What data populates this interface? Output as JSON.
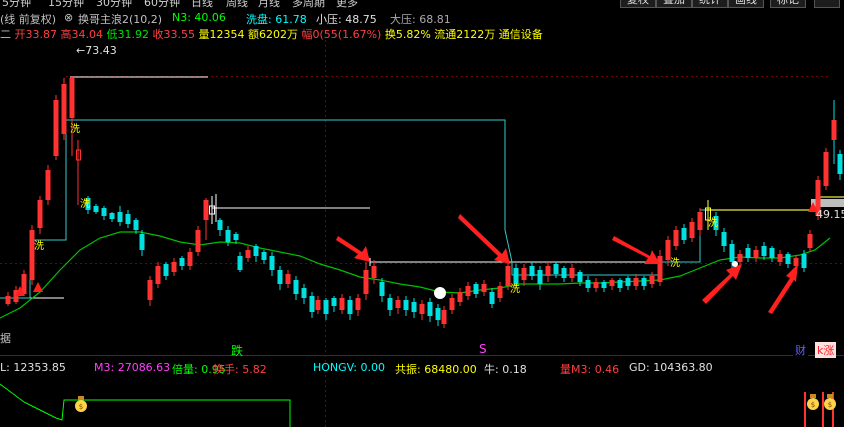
{
  "menu": {
    "periods": [
      "5分钟",
      "15分钟",
      "30分钟",
      "60分钟",
      "日线",
      "周线",
      "月线",
      "多周期",
      "更多"
    ],
    "right_buttons": [
      "复权",
      "叠加",
      "统计",
      "画线",
      "标记"
    ]
  },
  "header": {
    "adjust_label": "(线 前复权)",
    "indicator_name": "换哥主浪2(10,2)",
    "n3_label": "N3: 40.06",
    "xipan_label": "洗盘: 61.78",
    "xiaoya_label": "小压: 48.75",
    "daya_label": "大压: 68.81"
  },
  "quote": {
    "prefix": "二",
    "open": "开33.87",
    "high": "高34.04",
    "low": "低31.92",
    "close": "收33.55",
    "volume": "量12354",
    "amount": "额6202万",
    "change": "幅0(55(1.67%)",
    "turnover": "换5.82%",
    "float": "流通2122万",
    "sector": "通信设备"
  },
  "chart": {
    "high_price_label": "73.43",
    "right_price_label": "49.15",
    "left_edge_label": "据",
    "die_label": "跌",
    "s_label": "S",
    "cai_badge": "财",
    "liang_badge": "k涨",
    "xi_markers": [
      "洗",
      "洗",
      "洗",
      "洗",
      "洗",
      "洗"
    ]
  },
  "indicators": {
    "l_val": "L: 12353.85",
    "m3": "M3: 27086.63",
    "beiliang": "倍量: 0.95",
    "huanshou": "换手: 5.82",
    "hongv": "HONGV: 0.00",
    "gongzhen": "共振: 68480.00",
    "niu": "牛: 0.18",
    "liangm3": "量M3: 0.46",
    "gd": "GD: 104363.80"
  },
  "colors": {
    "up": "#ff3232",
    "down": "#00e0e0",
    "ma": "#00c000",
    "resist": "#ffffff",
    "label_yellow": "#ffff00",
    "label_green": "#00ff00",
    "label_magenta": "#ff40ff",
    "label_red": "#ff4040"
  }
}
